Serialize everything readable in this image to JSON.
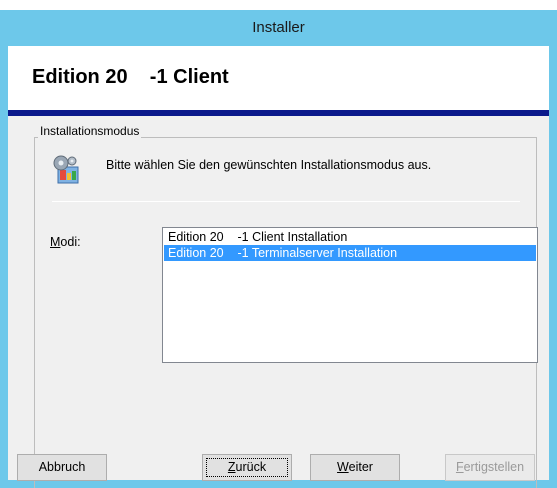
{
  "window": {
    "title": "Installer"
  },
  "header": {
    "title": "Edition 20    -1 Client"
  },
  "group": {
    "legend": "Installationsmodus",
    "instruction": "Bitte wählen Sie den gewünschten Installationsmodus aus.",
    "icon": "setup-icon"
  },
  "modi": {
    "label_prefix": "M",
    "label_rest": "odi:",
    "items": [
      {
        "label": "Edition 20    -1 Client Installation",
        "selected": false
      },
      {
        "label": "Edition 20    -1 Terminalserver Installation",
        "selected": true
      }
    ]
  },
  "buttons": {
    "cancel": "Abbruch",
    "back_accel": "Z",
    "back_rest": "urück",
    "next_accel": "W",
    "next_rest": "eiter",
    "finish_accel": "F",
    "finish_rest": "ertigstellen"
  },
  "colors": {
    "titlebar": "#6dc8ea",
    "header_rule": "#0b1a8c",
    "selection": "#3399ff"
  }
}
